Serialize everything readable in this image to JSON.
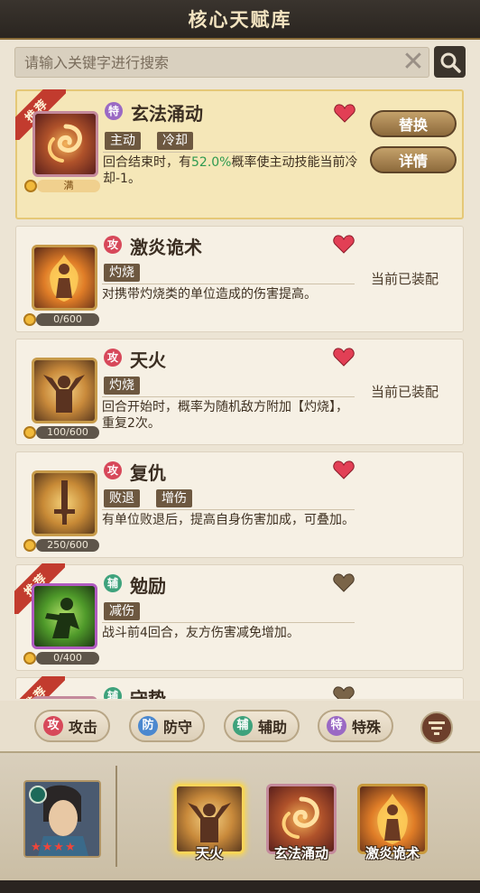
{
  "header": {
    "title": "核心天赋库"
  },
  "search": {
    "placeholder": "请输入关键字进行搜索"
  },
  "colors": {
    "accent_gold": "#e5c877",
    "attack": "#d7485a",
    "assist": "#3ea27c",
    "special": "#9a69c4",
    "defend": "#4b88cf",
    "highlight_value": "#2f9a50"
  },
  "skills": [
    {
      "ribbon": "推荐",
      "type_badge": "特",
      "name": "玄法涌动",
      "tags": [
        "主动",
        "冷却"
      ],
      "desc_a": "回合结束时，有",
      "desc_value": "52.0%",
      "desc_b": "概率使主动技能当前冷却-1。",
      "progress": "满",
      "replace_label": "替换",
      "detail_label": "详情",
      "icon": "swirl-icon"
    },
    {
      "type_badge": "攻",
      "name": "激炎诡术",
      "tags": [
        "灼烧"
      ],
      "desc": "对携带灼烧类的单位造成的伤害提高。",
      "progress": "0/600",
      "status": "当前已装配",
      "icon": "flame-figure-icon"
    },
    {
      "type_badge": "攻",
      "name": "天火",
      "tags": [
        "灼烧"
      ],
      "desc": "回合开始时，概率为随机敌方附加【灼烧】，重复2次。",
      "progress": "100/600",
      "status": "当前已装配",
      "icon": "fire-arms-icon"
    },
    {
      "type_badge": "攻",
      "name": "复仇",
      "tags": [
        "败退",
        "增伤"
      ],
      "desc": "有单位败退后，提高自身伤害加成，可叠加。",
      "progress": "250/600",
      "icon": "sword-icon"
    },
    {
      "ribbon": "推荐",
      "type_badge": "辅",
      "name": "勉励",
      "tags": [
        "减伤"
      ],
      "desc": "战斗前4回合，友方伤害减免增加。",
      "progress": "0/400",
      "icon": "green-warrior-icon"
    },
    {
      "ribbon": "推荐",
      "type_badge": "辅",
      "name": "守势"
    }
  ],
  "filters": [
    {
      "badge": "攻",
      "label": "攻击"
    },
    {
      "badge": "防",
      "label": "防守"
    },
    {
      "badge": "辅",
      "label": "辅助"
    },
    {
      "badge": "特",
      "label": "特殊"
    }
  ],
  "hero": {
    "stars": 4
  },
  "equipped_slots": [
    {
      "label": "天火",
      "icon": "fire-arms-icon"
    },
    {
      "label": "玄法涌动",
      "icon": "swirl-icon"
    },
    {
      "label": "激炎诡术",
      "icon": "flame-figure-icon"
    }
  ]
}
